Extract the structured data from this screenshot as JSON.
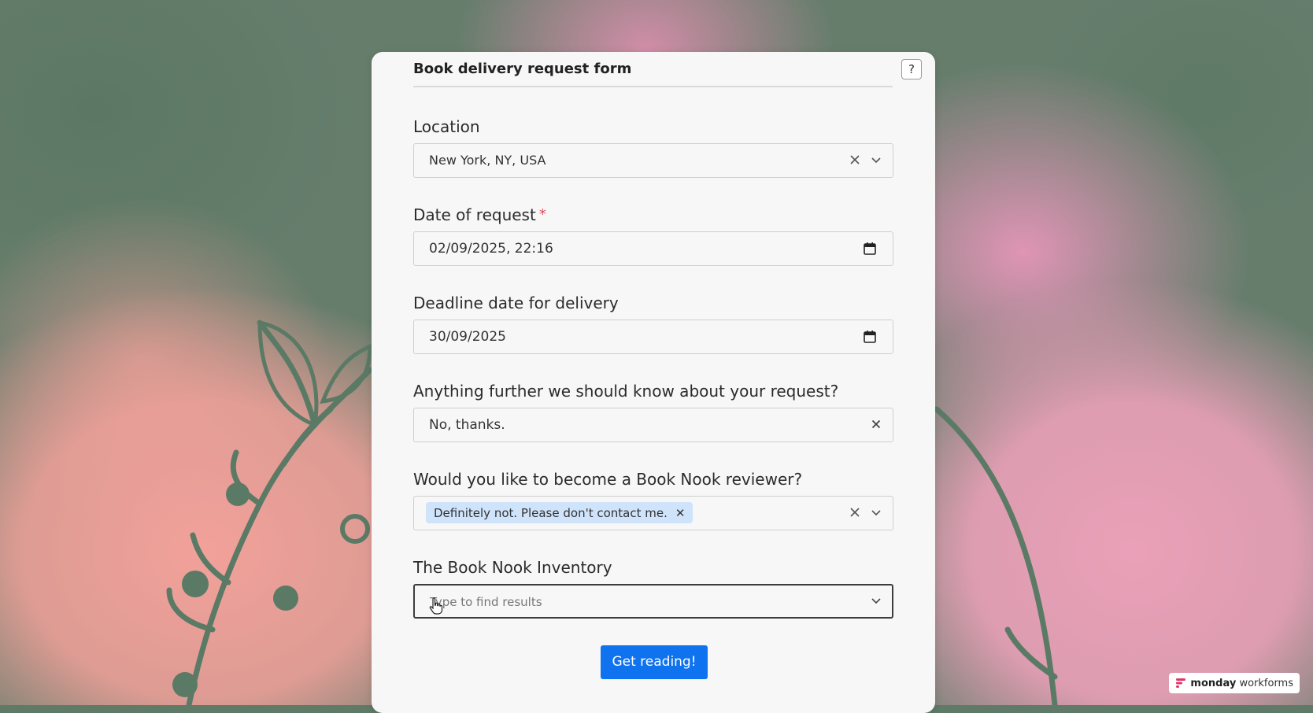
{
  "form": {
    "title": "Book delivery request form",
    "help": "?",
    "submit_label": "Get reading!"
  },
  "fields": {
    "location": {
      "label": "Location",
      "value": "New York, NY, USA"
    },
    "date_of_request": {
      "label": "Date of request",
      "required_mark": "*",
      "value": "02/09/2025, 22:16"
    },
    "deadline": {
      "label": "Deadline date for delivery",
      "value": "30/09/2025"
    },
    "further_info": {
      "label": "Anything further we should know about your request?",
      "value": "No, thanks."
    },
    "reviewer": {
      "label": "Would you like to become a Book Nook reviewer?",
      "tag": "Definitely not. Please don't contact me.",
      "tag_remove": "✕"
    },
    "inventory": {
      "label": "The Book Nook Inventory",
      "placeholder": "Type to find results"
    }
  },
  "branding": {
    "name_bold": "monday",
    "name_rest": "workforms"
  },
  "colors": {
    "primary": "#0f73f0",
    "tag_bg": "#cfe3fb",
    "required": "#d8505f"
  },
  "icons": {
    "clear": "close-icon",
    "dropdown": "chevron-down-icon",
    "calendar": "calendar-icon",
    "help": "help-icon"
  }
}
